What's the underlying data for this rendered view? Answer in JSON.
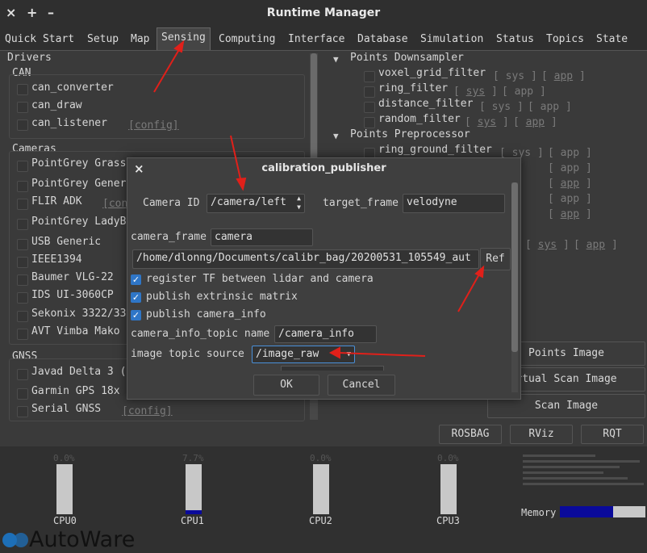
{
  "window": {
    "title": "Runtime Manager",
    "controls": [
      "×",
      "+",
      "–"
    ]
  },
  "tabs": [
    "Quick Start",
    "Setup",
    "Map",
    "Sensing",
    "Computing",
    "Interface",
    "Database",
    "Simulation",
    "Status",
    "Topics",
    "State"
  ],
  "drivers": {
    "title": "Drivers",
    "can": {
      "title": "CAN",
      "items": [
        "can_converter",
        "can_draw",
        "can_listener"
      ],
      "config_label": "[config]"
    },
    "cameras": {
      "title": "Cameras",
      "items": [
        "PointGrey Grass",
        "PointGrey Gener",
        "FLIR ADK",
        "PointGrey LadyB",
        "USB Generic",
        "IEEE1394",
        "Baumer VLG-22",
        "IDS UI-3060CP",
        "Sekonix 3322/33",
        "AVT Vimba Mako"
      ],
      "config_partial": "[con"
    },
    "gnss": {
      "title": "GNSS",
      "items": [
        "Javad Delta 3 (",
        "Garmin GPS 18x",
        "Serial GNSS"
      ],
      "config_label": "[config]"
    }
  },
  "filters": {
    "downsampler": {
      "title": "Points Downsampler",
      "items": [
        "voxel_grid_filter",
        "ring_filter",
        "distance_filter",
        "random_filter"
      ]
    },
    "preprocessor": {
      "title": "Points Preprocessor",
      "items": [
        "ring_ground_filter"
      ]
    },
    "sys_label": "sys",
    "app_label": "app"
  },
  "right_buttons": [
    "Points Image",
    "rtual Scan Image",
    "Scan Image"
  ],
  "tools": [
    "ROSBAG",
    "RViz",
    "RQT"
  ],
  "cpu": [
    {
      "name": "CPU0",
      "value": "0.0%",
      "fill": 0.0
    },
    {
      "name": "CPU1",
      "value": "7.7%",
      "fill": 0.077
    },
    {
      "name": "CPU2",
      "value": "0.0%",
      "fill": 0.0
    },
    {
      "name": "CPU3",
      "value": "0.0%",
      "fill": 0.0
    }
  ],
  "memory": {
    "label": "Memory",
    "fill": 0.62
  },
  "logo": "AutoWare",
  "dialog": {
    "title": "calibration_publisher",
    "close": "×",
    "camera_id_label": "Camera ID",
    "camera_id_value": "/camera/left",
    "target_frame_label": "target_frame",
    "target_frame_value": "velodyne",
    "camera_frame_label": "camera_frame",
    "camera_frame_value": "camera",
    "path_value": "/home/dlonng/Documents/calibr_bag/20200531_105549_aut",
    "ref_label": "Ref",
    "checks": [
      "register TF between lidar and camera",
      "publish extrinsic matrix",
      "publish camera_info"
    ],
    "camera_info_topic_label": "camera_info_topic name",
    "camera_info_topic_value": "/camera_info",
    "image_topic_label": "image topic source",
    "image_topic_value": "/image_raw",
    "ok_label": "OK",
    "cancel_label": "Cancel"
  },
  "colors": {
    "accent": "#2f76c7",
    "arrow": "#e0201a",
    "memory": "#0a0a9a"
  }
}
